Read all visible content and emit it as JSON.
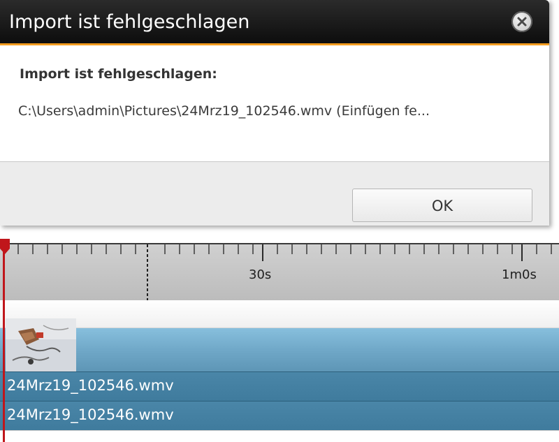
{
  "dialog": {
    "title": "Import ist fehlgeschlagen",
    "heading": "Import ist fehlgeschlagen:",
    "message": "C:\\Users\\admin\\Pictures\\24Mrz19_102546.wmv   (Einfügen fe...",
    "ok_label": "OK",
    "close_icon": "close-icon",
    "accent_color": "#f39c1f"
  },
  "timeline": {
    "ticks": [
      "30s",
      "1m0s"
    ],
    "clips": [
      {
        "name": "24Mrz19_102546.wmv"
      },
      {
        "name": "24Mrz19_102546.wmv"
      }
    ],
    "playhead_color": "#c0161b",
    "track_color": "#6ea6c6"
  }
}
